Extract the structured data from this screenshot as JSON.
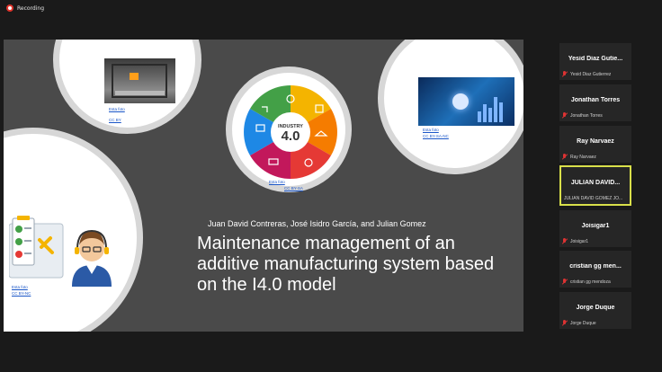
{
  "recording": {
    "label": "Recording"
  },
  "slide": {
    "authors": "Juan David Contreras, José Isidro García, and Julian Gomez",
    "title": "Maintenance management of an additive manufacturing system based on the I4.0 model",
    "wheel": {
      "label_top": "INDUSTRY",
      "label_main": "4.0"
    },
    "credits": [
      {
        "link": "Esta foto",
        "license": "CC BY"
      },
      {
        "link": "Esta foto",
        "license": "CC BY-SA-NC"
      },
      {
        "link": "Esta foto",
        "license": "CC BY-SA"
      },
      {
        "link": "Esta foto",
        "license": "CC BY-NC"
      }
    ]
  },
  "participants": [
    {
      "name": "Yesid  Diaz  Gutie...",
      "label": "Yesid Diaz Gutierrez",
      "muted": true,
      "active": false
    },
    {
      "name": "Jonathan Torres",
      "label": "Jonathan Torres",
      "muted": true,
      "active": false
    },
    {
      "name": "Ray Narvaez",
      "label": "Ray Narvaez",
      "muted": true,
      "active": false
    },
    {
      "name": "JULIAN  DAVID...",
      "label": "JULIAN DAVID GOMEZ JO...",
      "muted": false,
      "active": true
    },
    {
      "name": "Joisigar1",
      "label": "Joisigar1",
      "muted": true,
      "active": false
    },
    {
      "name": "cristian  gg  men...",
      "label": "cristian gg mendoza",
      "muted": true,
      "active": false
    },
    {
      "name": "Jorge Duque",
      "label": "Jorge Duque",
      "muted": true,
      "active": false
    }
  ],
  "colors": {
    "active_border": "#d9e04a",
    "recording_dot": "#e0332b",
    "slide_bg": "#4a4a4a"
  }
}
